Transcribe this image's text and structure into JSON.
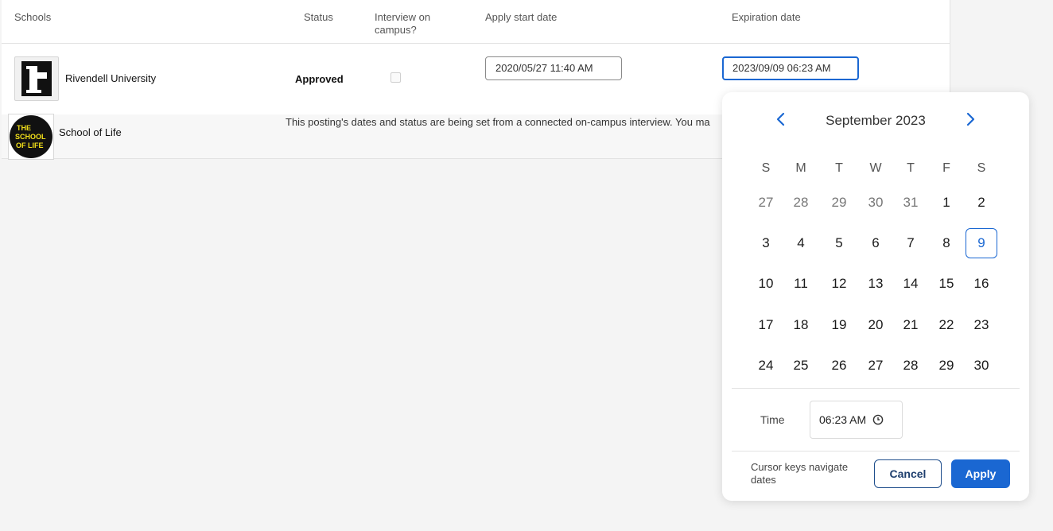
{
  "table": {
    "headers": {
      "schools": "Schools",
      "status": "Status",
      "interview_line1": "Interview on",
      "interview_line2": "campus?",
      "apply_start": "Apply start date",
      "expiration": "Expiration date"
    },
    "rows": [
      {
        "school": "Rivendell University",
        "status": "Approved",
        "interview_on_campus": false,
        "apply_start": "2020/05/27 11:40 AM",
        "expiration": "2023/09/09 06:23 AM"
      },
      {
        "school": "School of Life",
        "notice": "This posting's dates and status are being set from a connected on-campus interview. You ma"
      }
    ],
    "logos": {
      "sol_line1": "THE",
      "sol_line2": "SCHOOL",
      "sol_line3": "OF LIFE"
    }
  },
  "date_picker": {
    "month_label": "September 2023",
    "prev_icon": "chevron-left-icon",
    "next_icon": "chevron-right-icon",
    "weekdays": [
      "S",
      "M",
      "T",
      "W",
      "T",
      "F",
      "S"
    ],
    "weeks": [
      [
        "27",
        "28",
        "29",
        "30",
        "31",
        "1",
        "2"
      ],
      [
        "3",
        "4",
        "5",
        "6",
        "7",
        "8",
        "9"
      ],
      [
        "10",
        "11",
        "12",
        "13",
        "14",
        "15",
        "16"
      ],
      [
        "17",
        "18",
        "19",
        "20",
        "21",
        "22",
        "23"
      ],
      [
        "24",
        "25",
        "26",
        "27",
        "28",
        "29",
        "30"
      ]
    ],
    "selected_day": "9",
    "time_label": "Time",
    "time_value": "06:23 AM",
    "time_icon": "clock-icon",
    "hint": "Cursor keys navigate dates",
    "cancel_label": "Cancel",
    "apply_label": "Apply"
  },
  "colors": {
    "accent": "#1a67d2",
    "logo_yellow": "#f2e01a"
  }
}
